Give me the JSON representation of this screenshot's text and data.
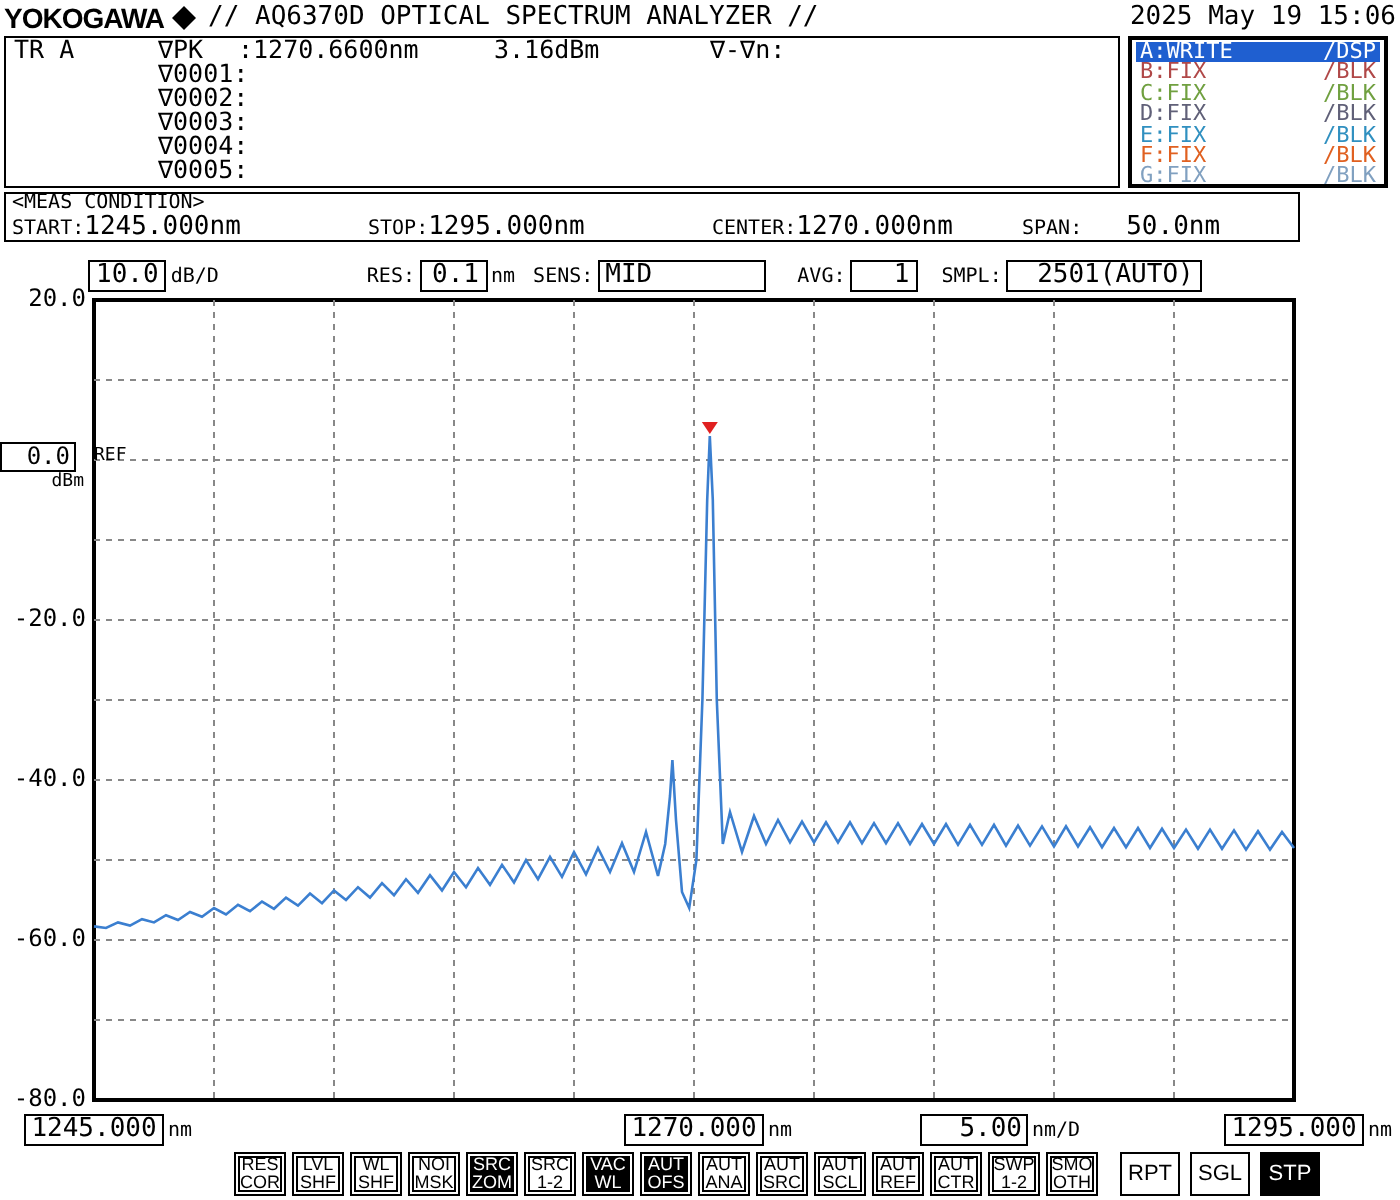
{
  "header": {
    "brand": "YOKOGAWA",
    "title": "// AQ6370D OPTICAL SPECTRUM ANALYZER //",
    "datetime": "2025 May 19 15:06"
  },
  "marker_panel": {
    "trace": "TR A",
    "rows": [
      {
        "marker": "∇PK",
        "value": ":1270.6600nm",
        "power": "3.16dBm",
        "delta": "∇-∇n:"
      },
      {
        "marker": "∇0001:"
      },
      {
        "marker": "∇0002:"
      },
      {
        "marker": "∇0003:"
      },
      {
        "marker": "∇0004:"
      },
      {
        "marker": "∇0005:"
      }
    ]
  },
  "traces": [
    {
      "name": "A:WRITE",
      "mode": "/DSP",
      "color": "#1f5fd0",
      "selected": true
    },
    {
      "name": "B:FIX",
      "mode": "/BLK",
      "color": "#b04848",
      "selected": false
    },
    {
      "name": "C:FIX",
      "mode": "/BLK",
      "color": "#70a040",
      "selected": false
    },
    {
      "name": "D:FIX",
      "mode": "/BLK",
      "color": "#606078",
      "selected": false
    },
    {
      "name": "E:FIX",
      "mode": "/BLK",
      "color": "#3090c0",
      "selected": false
    },
    {
      "name": "F:FIX",
      "mode": "/BLK",
      "color": "#e06020",
      "selected": false
    },
    {
      "name": "G:FIX",
      "mode": "/BLK",
      "color": "#80a0c0",
      "selected": false
    }
  ],
  "meas_condition": {
    "title": "<MEAS CONDITION>",
    "items": [
      {
        "label": "START:",
        "value": "1245.000nm"
      },
      {
        "label": "STOP:",
        "value": "1295.000nm"
      },
      {
        "label": "CENTER:",
        "value": "1270.000nm"
      },
      {
        "label": "SPAN:",
        "value": "50.0nm"
      }
    ]
  },
  "settings": [
    {
      "value": "10.0",
      "unit": "dB/D"
    },
    {
      "label": "RES:",
      "value": "0.1",
      "unit": "nm"
    },
    {
      "label": "SENS:",
      "value": "MID"
    },
    {
      "label": "AVG:",
      "value": "1"
    },
    {
      "label": "SMPL:",
      "value": "2501(AUTO)"
    }
  ],
  "ref": {
    "value": "0.0",
    "label": "REF",
    "unit": "dBm"
  },
  "chart_data": {
    "type": "line",
    "grid": true,
    "xlim": [
      1245,
      1295
    ],
    "ylim": [
      -80,
      20
    ],
    "yticks": [
      {
        "value": 20,
        "label": "20.0"
      },
      {
        "value": -20,
        "label": "-20.0"
      },
      {
        "value": -40,
        "label": "-40.0"
      },
      {
        "value": -60,
        "label": "-60.0"
      },
      {
        "value": -80,
        "label": "-80.0"
      }
    ],
    "xticks": [
      {
        "value": 1245,
        "label": "1245.000"
      },
      {
        "value": 1270,
        "label": "1270.000"
      },
      {
        "value": 1295,
        "label": "1295.000"
      }
    ],
    "x": [
      1245,
      1245.5,
      1246,
      1246.5,
      1247,
      1247.5,
      1248,
      1248.5,
      1249,
      1249.5,
      1250,
      1250.5,
      1251,
      1251.5,
      1252,
      1252.5,
      1253,
      1253.5,
      1254,
      1254.5,
      1255,
      1255.5,
      1256,
      1256.5,
      1257,
      1257.5,
      1258,
      1258.5,
      1259,
      1259.5,
      1260,
      1260.5,
      1261,
      1261.5,
      1262,
      1262.5,
      1263,
      1263.5,
      1264,
      1264.5,
      1265,
      1265.5,
      1266,
      1266.5,
      1267,
      1267.5,
      1268,
      1268.5,
      1268.8,
      1269,
      1269.1,
      1269.25,
      1269.5,
      1269.8,
      1270.1,
      1270.35,
      1270.55,
      1270.66,
      1270.78,
      1270.95,
      1271.2,
      1271.5,
      1272,
      1272.5,
      1273,
      1273.5,
      1274,
      1274.5,
      1275,
      1275.5,
      1276,
      1276.5,
      1277,
      1277.5,
      1278,
      1278.5,
      1279,
      1279.5,
      1280,
      1280.5,
      1281,
      1281.5,
      1282,
      1282.5,
      1283,
      1283.5,
      1284,
      1284.5,
      1285,
      1285.5,
      1286,
      1286.5,
      1287,
      1287.5,
      1288,
      1288.5,
      1289,
      1289.5,
      1290,
      1290.5,
      1291,
      1291.5,
      1292,
      1292.5,
      1293,
      1293.5,
      1294,
      1294.5,
      1295
    ],
    "series": [
      {
        "color": "#3b7fd0",
        "values": [
          -58.3,
          -58.5,
          -57.8,
          -58.2,
          -57.4,
          -57.8,
          -56.9,
          -57.5,
          -56.5,
          -57.1,
          -56.0,
          -56.8,
          -55.6,
          -56.4,
          -55.2,
          -56.1,
          -54.7,
          -55.7,
          -54.2,
          -55.4,
          -53.8,
          -55.0,
          -53.4,
          -54.7,
          -52.9,
          -54.4,
          -52.4,
          -54.1,
          -51.9,
          -53.8,
          -51.5,
          -53.4,
          -51.0,
          -53.1,
          -50.6,
          -52.8,
          -50.0,
          -52.4,
          -49.6,
          -52.1,
          -49.0,
          -51.8,
          -48.5,
          -51.5,
          -47.9,
          -51.5,
          -46.5,
          -52.0,
          -48,
          -42,
          -37.5,
          -45,
          -54,
          -56,
          -50,
          -30,
          -5,
          3,
          -5,
          -30,
          -48,
          -44,
          -49,
          -44.5,
          -48,
          -45,
          -47.8,
          -45.2,
          -47.8,
          -45.3,
          -47.8,
          -45.3,
          -47.9,
          -45.4,
          -47.9,
          -45.4,
          -48.0,
          -45.5,
          -48.0,
          -45.5,
          -48.1,
          -45.6,
          -48.1,
          -45.6,
          -48.2,
          -45.7,
          -48.2,
          -45.8,
          -48.3,
          -45.8,
          -48.3,
          -45.9,
          -48.4,
          -46.0,
          -48.4,
          -46.0,
          -48.5,
          -46.1,
          -48.5,
          -46.2,
          -48.6,
          -46.2,
          -48.6,
          -46.3,
          -48.7,
          -46.4,
          -48.7,
          -46.5,
          -48.5
        ]
      }
    ]
  },
  "x_tick_units": [
    "nm",
    "nm",
    "nm"
  ],
  "x_scale": {
    "value": "5.00",
    "unit": "nm/D"
  },
  "soft_keys": [
    {
      "top": "RES",
      "bottom": "COR",
      "selected": false
    },
    {
      "top": "LVL",
      "bottom": "SHF",
      "selected": false
    },
    {
      "top": "WL",
      "bottom": "SHF",
      "selected": false
    },
    {
      "top": "NOI",
      "bottom": "MSK",
      "selected": false
    },
    {
      "top": "SRC",
      "bottom": "ZOM",
      "selected": true
    },
    {
      "top": "SRC",
      "bottom": "1-2",
      "selected": false
    },
    {
      "top": "VAC",
      "bottom": "WL",
      "selected": true
    },
    {
      "top": "AUT",
      "bottom": "OFS",
      "selected": true
    },
    {
      "top": "AUT",
      "bottom": "ANA",
      "selected": false
    },
    {
      "top": "AUT",
      "bottom": "SRC",
      "selected": false
    },
    {
      "top": "AUT",
      "bottom": "SCL",
      "selected": false
    },
    {
      "top": "AUT",
      "bottom": "REF",
      "selected": false
    },
    {
      "top": "AUT",
      "bottom": "CTR",
      "selected": false
    },
    {
      "top": "SWP",
      "bottom": "1-2",
      "selected": false
    },
    {
      "top": "SMO",
      "bottom": "OTH",
      "selected": false
    }
  ],
  "sweep_buttons": [
    {
      "label": "RPT",
      "selected": false
    },
    {
      "label": "SGL",
      "selected": false
    },
    {
      "label": "STP",
      "selected": true
    }
  ]
}
